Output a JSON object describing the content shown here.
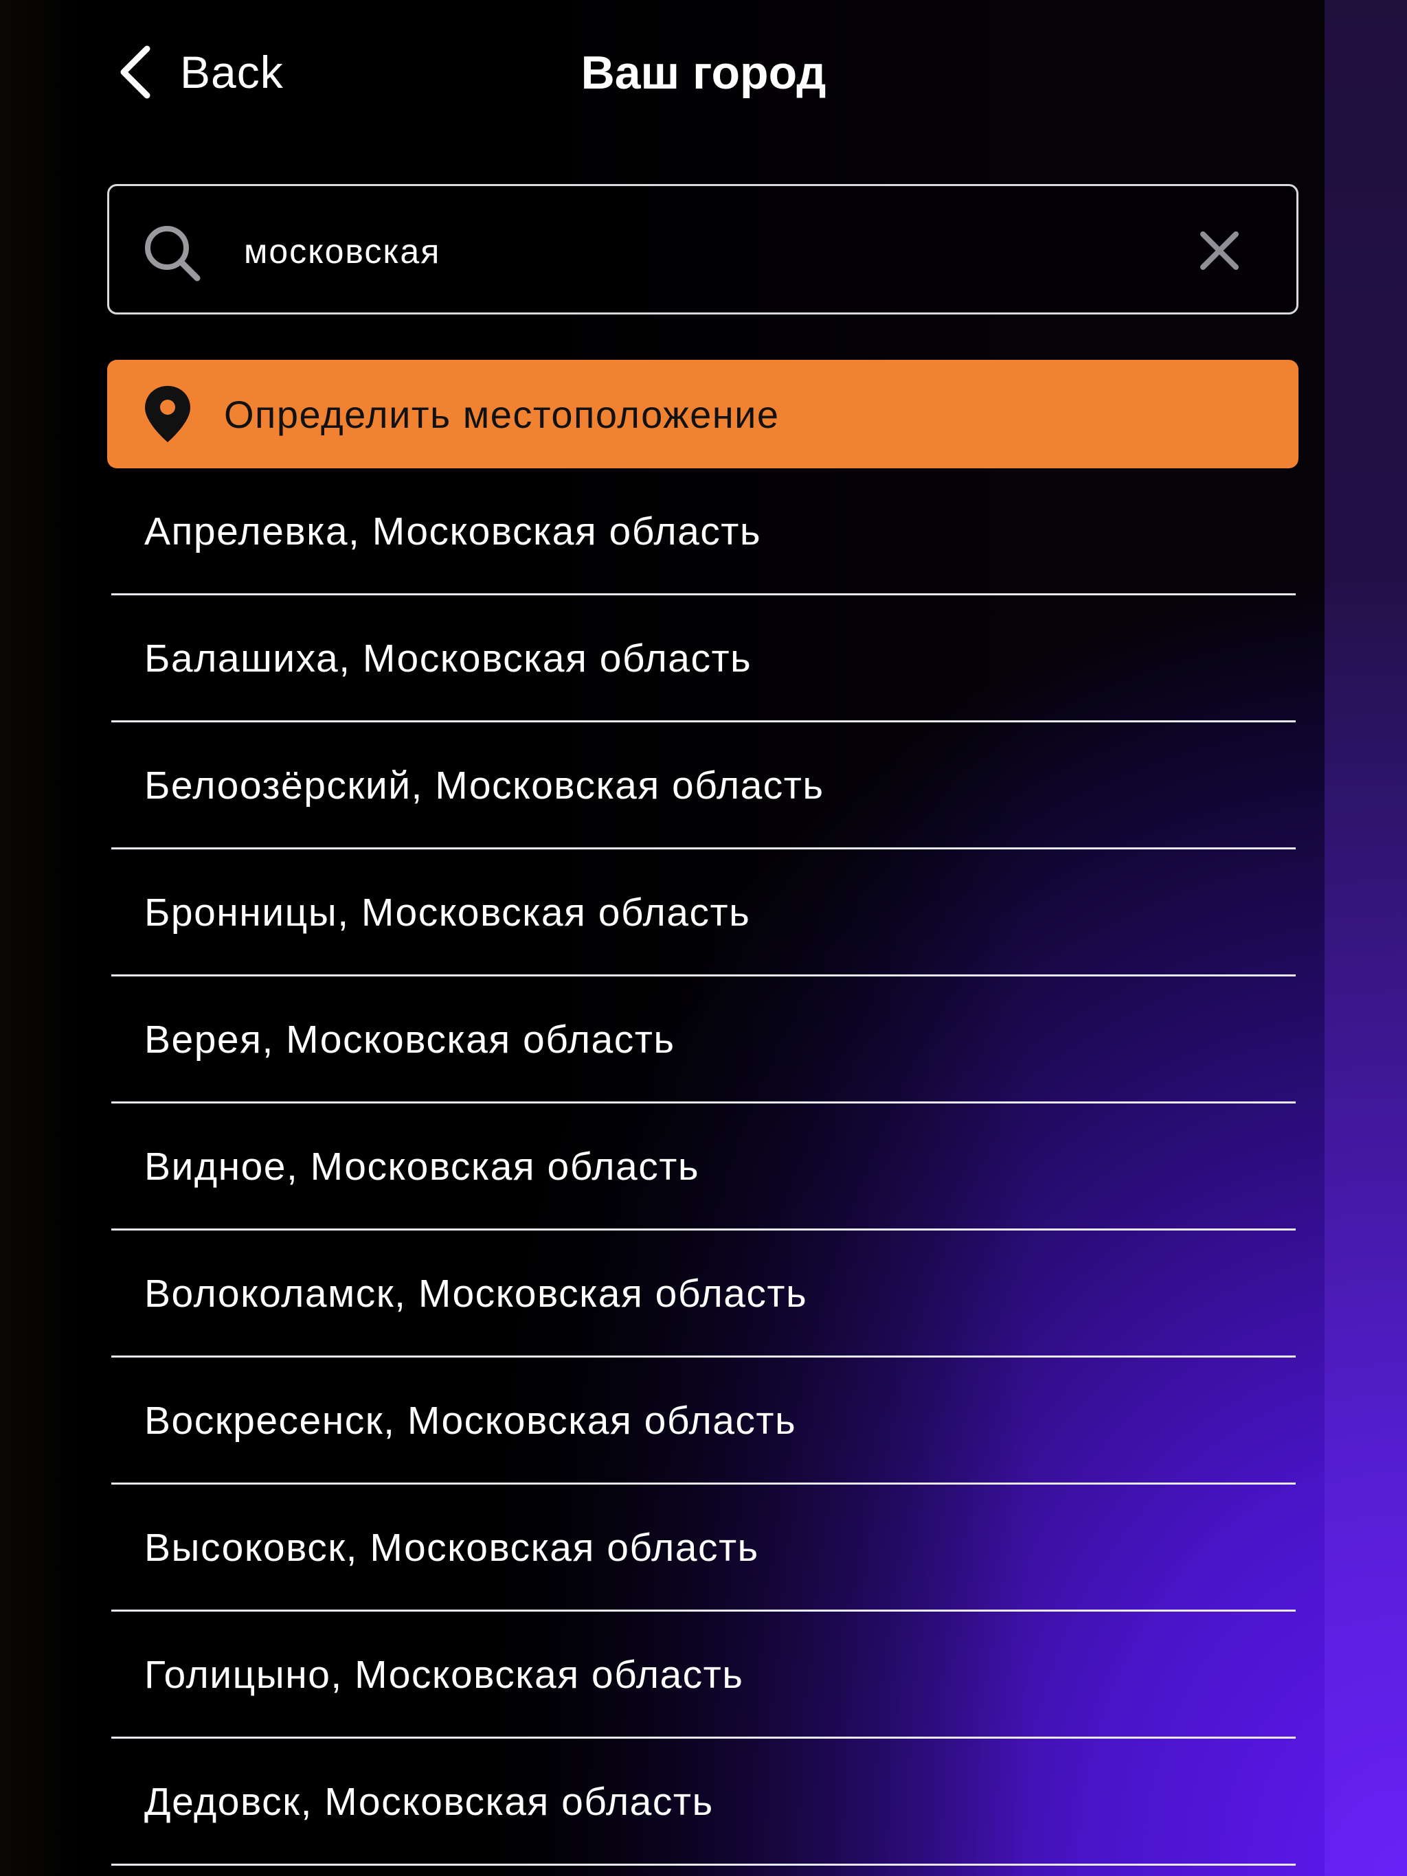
{
  "colors": {
    "accent": "#f08232",
    "text": "#ffffff",
    "divider": "#e8e8ee",
    "gradient_dark": "#000000",
    "gradient_purple": "#6019f2"
  },
  "header": {
    "back_label": "Back",
    "back_icon": "chevron-left-icon",
    "title": "Ваш город"
  },
  "search": {
    "value": "московская",
    "search_icon": "search-icon",
    "clear_icon": "close-icon"
  },
  "locate": {
    "label": "Определить местоположение",
    "icon": "map-pin-icon"
  },
  "cities": [
    {
      "label": "Апрелевка, Московская область"
    },
    {
      "label": "Балашиха, Московская область"
    },
    {
      "label": "Белоозёрский, Московская область"
    },
    {
      "label": "Бронницы, Московская область"
    },
    {
      "label": "Верея, Московская область"
    },
    {
      "label": "Видное, Московская область"
    },
    {
      "label": "Волоколамск, Московская область"
    },
    {
      "label": "Воскресенск, Московская область"
    },
    {
      "label": "Высоковск, Московская область"
    },
    {
      "label": "Голицыно, Московская область"
    },
    {
      "label": "Дедовск, Московская область"
    }
  ]
}
